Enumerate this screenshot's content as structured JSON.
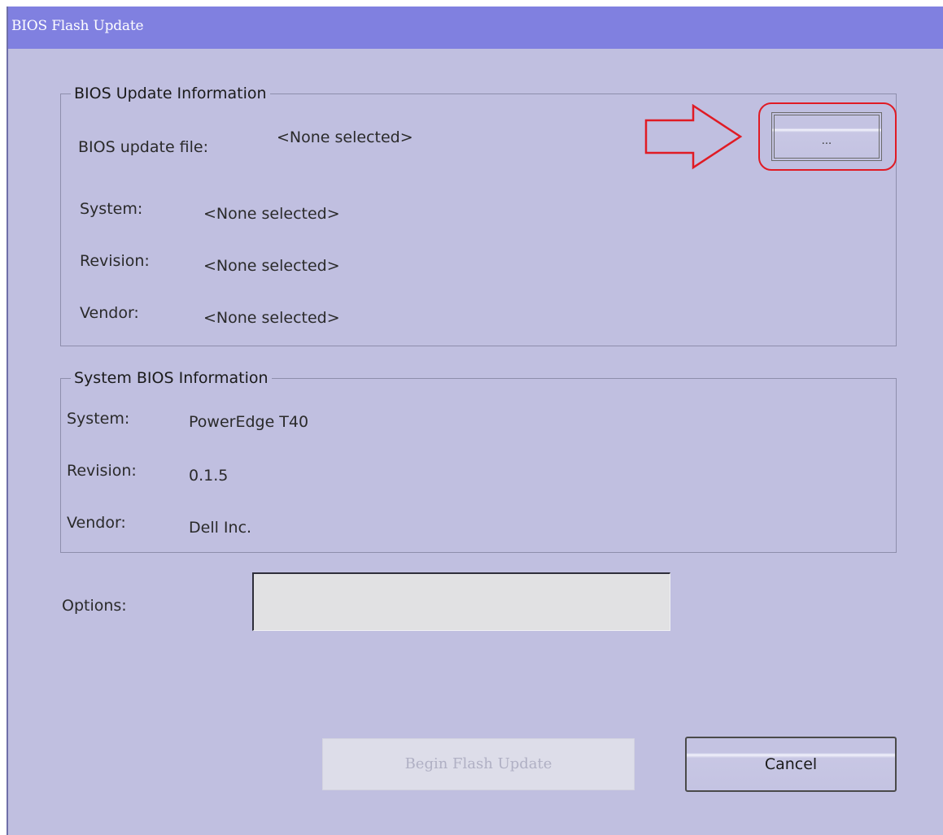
{
  "window": {
    "title": "BIOS Flash Update"
  },
  "update_info": {
    "legend": "BIOS Update Information",
    "file_label": "BIOS update file:",
    "file_value": "<None selected>",
    "browse_label": "...",
    "system_label": "System:",
    "system_value": "<None selected>",
    "revision_label": "Revision:",
    "revision_value": "<None selected>",
    "vendor_label": "Vendor:",
    "vendor_value": "<None selected>"
  },
  "system_info": {
    "legend": "System BIOS Information",
    "system_label": "System:",
    "system_value": "PowerEdge T40",
    "revision_label": "Revision:",
    "revision_value": "0.1.5",
    "vendor_label": "Vendor:",
    "vendor_value": "Dell Inc."
  },
  "options": {
    "label": "Options:",
    "value": ""
  },
  "buttons": {
    "begin_label": "Begin Flash Update",
    "cancel_label": "Cancel"
  },
  "colors": {
    "window_bg": "#c0bfe0",
    "titlebar_bg": "#8080e0",
    "highlight_red": "#e01b24"
  },
  "icons": {
    "annotation": "right-arrow-icon"
  }
}
